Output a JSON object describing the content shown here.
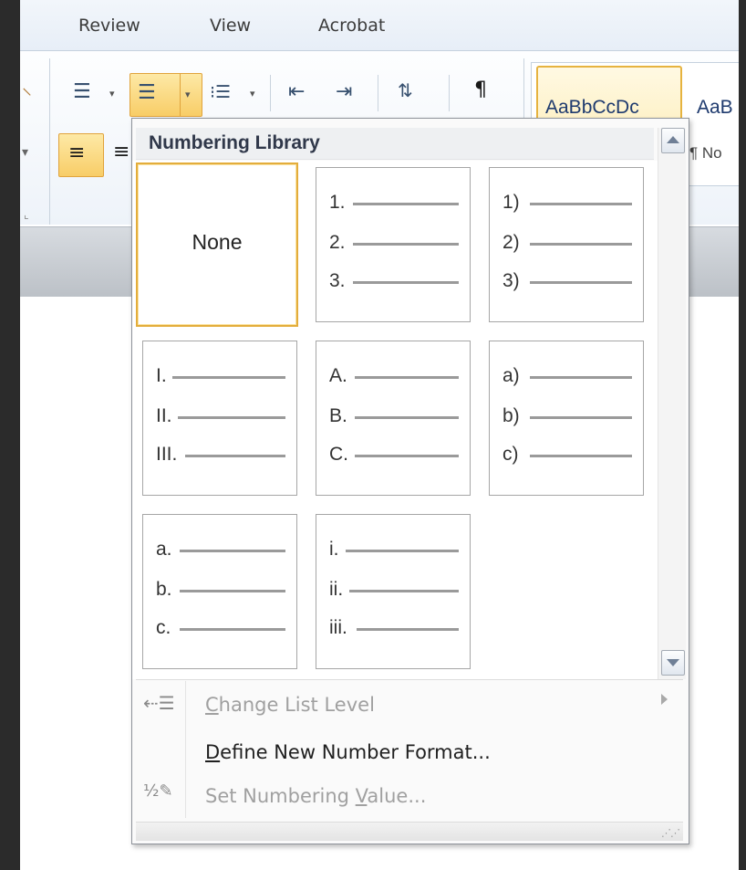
{
  "ribbon": {
    "tabs": [
      "Review",
      "View",
      "Acrobat"
    ],
    "styles": {
      "normal_preview": "AaBbCcDc",
      "next_preview": "AaB",
      "normal_label": "¶ No"
    }
  },
  "dropdown": {
    "header": "Numbering Library",
    "tiles": [
      {
        "label": "None",
        "selected": true
      },
      {
        "items": [
          "1.",
          "2.",
          "3."
        ]
      },
      {
        "items": [
          "1)",
          "2)",
          "3)"
        ]
      },
      {
        "items": [
          "I.",
          "II.",
          "III."
        ]
      },
      {
        "items": [
          "A.",
          "B.",
          "C."
        ]
      },
      {
        "items": [
          "a)",
          "b)",
          "c)"
        ]
      },
      {
        "items": [
          "a.",
          "b.",
          "c."
        ]
      },
      {
        "items": [
          "i.",
          "ii.",
          "iii."
        ]
      }
    ],
    "menu": [
      {
        "label": "Change List Level",
        "mnemonic": "C",
        "disabled": true,
        "submenu": true,
        "icon": "change-list-level-icon"
      },
      {
        "label": "Define New Number Format...",
        "mnemonic": "D",
        "disabled": false,
        "submenu": false,
        "icon": ""
      },
      {
        "label": "Set Numbering Value...",
        "mnemonic": "V",
        "disabled": true,
        "submenu": false,
        "icon": "set-numbering-value-icon"
      }
    ],
    "accent_color": "#e3ad3c"
  }
}
